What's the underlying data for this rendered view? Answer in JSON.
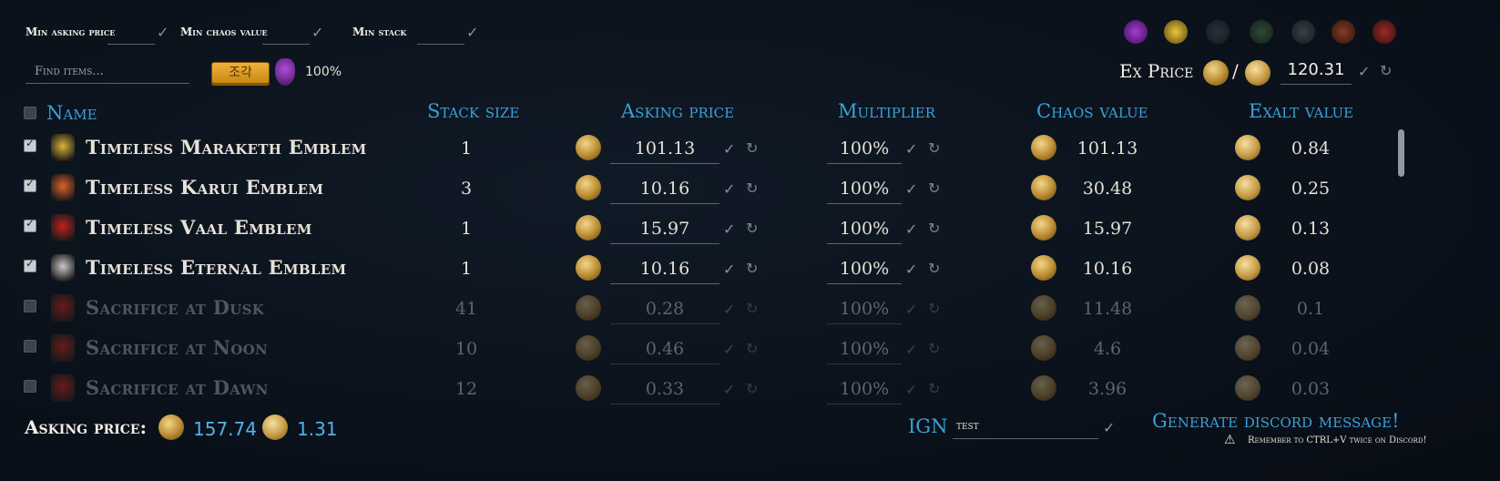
{
  "filters": {
    "min_asking_price_label": "Min asking price",
    "min_chaos_value_label": "Min chaos value",
    "min_stack_label": "Min stack",
    "find_placeholder": "Find items...",
    "language_button": "조각",
    "price_percent": "100%"
  },
  "ex_price": {
    "label": "Ex Price",
    "separator": "/",
    "value": "120.31"
  },
  "columns": {
    "name": "Name",
    "stack_size": "Stack size",
    "asking_price": "Asking price",
    "multiplier": "Multiplier",
    "chaos_value": "Chaos value",
    "exalt_value": "Exalt value"
  },
  "rows": [
    {
      "name": "Timeless Maraketh Emblem",
      "stack": "1",
      "asking": "101.13",
      "multiplier": "100%",
      "chaos": "101.13",
      "exalt": "0.84",
      "checked": true,
      "icon_color": "#d8b43a"
    },
    {
      "name": "Timeless Karui Emblem",
      "stack": "3",
      "asking": "10.16",
      "multiplier": "100%",
      "chaos": "30.48",
      "exalt": "0.25",
      "checked": true,
      "icon_color": "#e0602a"
    },
    {
      "name": "Timeless Vaal Emblem",
      "stack": "1",
      "asking": "15.97",
      "multiplier": "100%",
      "chaos": "15.97",
      "exalt": "0.13",
      "checked": true,
      "icon_color": "#c02020"
    },
    {
      "name": "Timeless Eternal Emblem",
      "stack": "1",
      "asking": "10.16",
      "multiplier": "100%",
      "chaos": "10.16",
      "exalt": "0.08",
      "checked": true,
      "icon_color": "#c8c8c8"
    },
    {
      "name": "Sacrifice at Dusk",
      "stack": "41",
      "asking": "0.28",
      "multiplier": "100%",
      "chaos": "11.48",
      "exalt": "0.1",
      "checked": false,
      "icon_color": "#6a1a1a"
    },
    {
      "name": "Sacrifice at Noon",
      "stack": "10",
      "asking": "0.46",
      "multiplier": "100%",
      "chaos": "4.6",
      "exalt": "0.04",
      "checked": false,
      "icon_color": "#6a1a1a"
    },
    {
      "name": "Sacrifice at Dawn",
      "stack": "12",
      "asking": "0.33",
      "multiplier": "100%",
      "chaos": "3.96",
      "exalt": "0.03",
      "checked": false,
      "icon_color": "#6a1a1a"
    }
  ],
  "footer": {
    "asking_price_label": "Asking price:",
    "total_chaos": "157.74",
    "total_exalt": "1.31",
    "ign_label": "IGN",
    "ign_value": "test",
    "generate_button": "Generate discord message!",
    "note": "Remember to CTRL+V twice on Discord!"
  },
  "icons": {
    "check": "check-icon",
    "refresh": "refresh-icon",
    "chaos": "chaos-orb-icon",
    "exalt": "exalted-orb-icon",
    "feather": "feather-icon",
    "warning": "warning-icon"
  },
  "colors": {
    "accent": "#3aa0d6",
    "value_blue": "#52b4e6",
    "button_gold": "#e0a32a"
  }
}
